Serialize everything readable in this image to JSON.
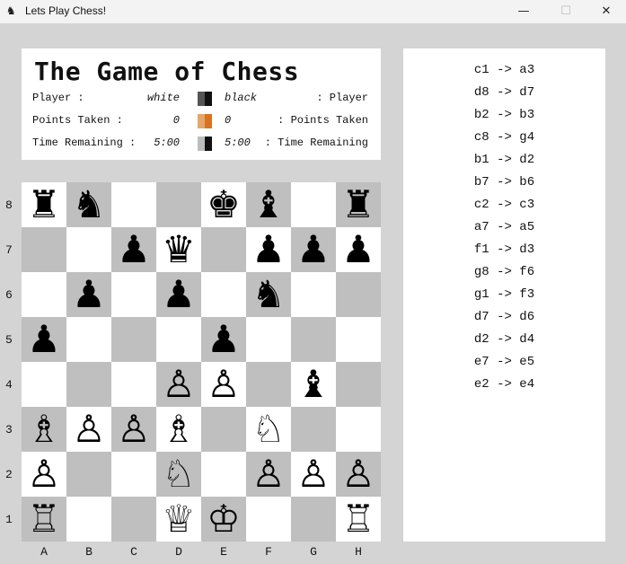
{
  "window": {
    "title": "Lets Play Chess!",
    "min_icon": "minimize-icon",
    "max_icon": "maximize-icon",
    "close_icon": "close-icon"
  },
  "header": {
    "title": "The Game of Chess",
    "player_label_left": "Player :",
    "player_white": "white",
    "player_black": "black",
    "player_label_right": ": Player",
    "points_label_left": "Points Taken :",
    "points_white": "0",
    "points_black": "0",
    "points_label_right": ": Points Taken",
    "time_label_left": "Time Remaining :",
    "time_white": "5:00",
    "time_black": "5:00",
    "time_label_right": ": Time Remaining",
    "swatches": {
      "player": [
        "#555555",
        "#111111"
      ],
      "points": [
        "#e3a76a",
        "#d9731f"
      ],
      "time": [
        "#bdbdbd",
        "#111111"
      ]
    }
  },
  "board": {
    "files": [
      "A",
      "B",
      "C",
      "D",
      "E",
      "F",
      "G",
      "H"
    ],
    "ranks": [
      "8",
      "7",
      "6",
      "5",
      "4",
      "3",
      "2",
      "1"
    ],
    "pieces": [
      {
        "square": "a8",
        "color": "black",
        "type": "rook"
      },
      {
        "square": "b8",
        "color": "black",
        "type": "knight"
      },
      {
        "square": "e8",
        "color": "black",
        "type": "king"
      },
      {
        "square": "f8",
        "color": "black",
        "type": "bishop"
      },
      {
        "square": "h8",
        "color": "black",
        "type": "rook"
      },
      {
        "square": "c7",
        "color": "black",
        "type": "pawn"
      },
      {
        "square": "d7",
        "color": "black",
        "type": "queen"
      },
      {
        "square": "f7",
        "color": "black",
        "type": "pawn"
      },
      {
        "square": "g7",
        "color": "black",
        "type": "pawn"
      },
      {
        "square": "h7",
        "color": "black",
        "type": "pawn"
      },
      {
        "square": "b6",
        "color": "black",
        "type": "pawn"
      },
      {
        "square": "d6",
        "color": "black",
        "type": "pawn"
      },
      {
        "square": "f6",
        "color": "black",
        "type": "knight"
      },
      {
        "square": "a5",
        "color": "black",
        "type": "pawn"
      },
      {
        "square": "e5",
        "color": "black",
        "type": "pawn"
      },
      {
        "square": "d4",
        "color": "white",
        "type": "pawn"
      },
      {
        "square": "e4",
        "color": "white",
        "type": "pawn"
      },
      {
        "square": "g4",
        "color": "black",
        "type": "bishop"
      },
      {
        "square": "a3",
        "color": "white",
        "type": "bishop"
      },
      {
        "square": "b3",
        "color": "white",
        "type": "pawn"
      },
      {
        "square": "c3",
        "color": "white",
        "type": "pawn"
      },
      {
        "square": "d3",
        "color": "white",
        "type": "bishop"
      },
      {
        "square": "f3",
        "color": "white",
        "type": "knight"
      },
      {
        "square": "a2",
        "color": "white",
        "type": "pawn"
      },
      {
        "square": "d2",
        "color": "white",
        "type": "knight"
      },
      {
        "square": "f2",
        "color": "white",
        "type": "pawn"
      },
      {
        "square": "g2",
        "color": "white",
        "type": "pawn"
      },
      {
        "square": "h2",
        "color": "white",
        "type": "pawn"
      },
      {
        "square": "a1",
        "color": "white",
        "type": "rook"
      },
      {
        "square": "d1",
        "color": "white",
        "type": "queen"
      },
      {
        "square": "e1",
        "color": "white",
        "type": "king"
      },
      {
        "square": "h1",
        "color": "white",
        "type": "rook"
      }
    ]
  },
  "moves": [
    "c1 -> a3",
    "d8 -> d7",
    "b2 -> b3",
    "c8 -> g4",
    "b1 -> d2",
    "b7 -> b6",
    "c2 -> c3",
    "a7 -> a5",
    "f1 -> d3",
    "g8 -> f6",
    "g1 -> f3",
    "d7 -> d6",
    "d2 -> d4",
    "e7 -> e5",
    "e2 -> e4"
  ]
}
